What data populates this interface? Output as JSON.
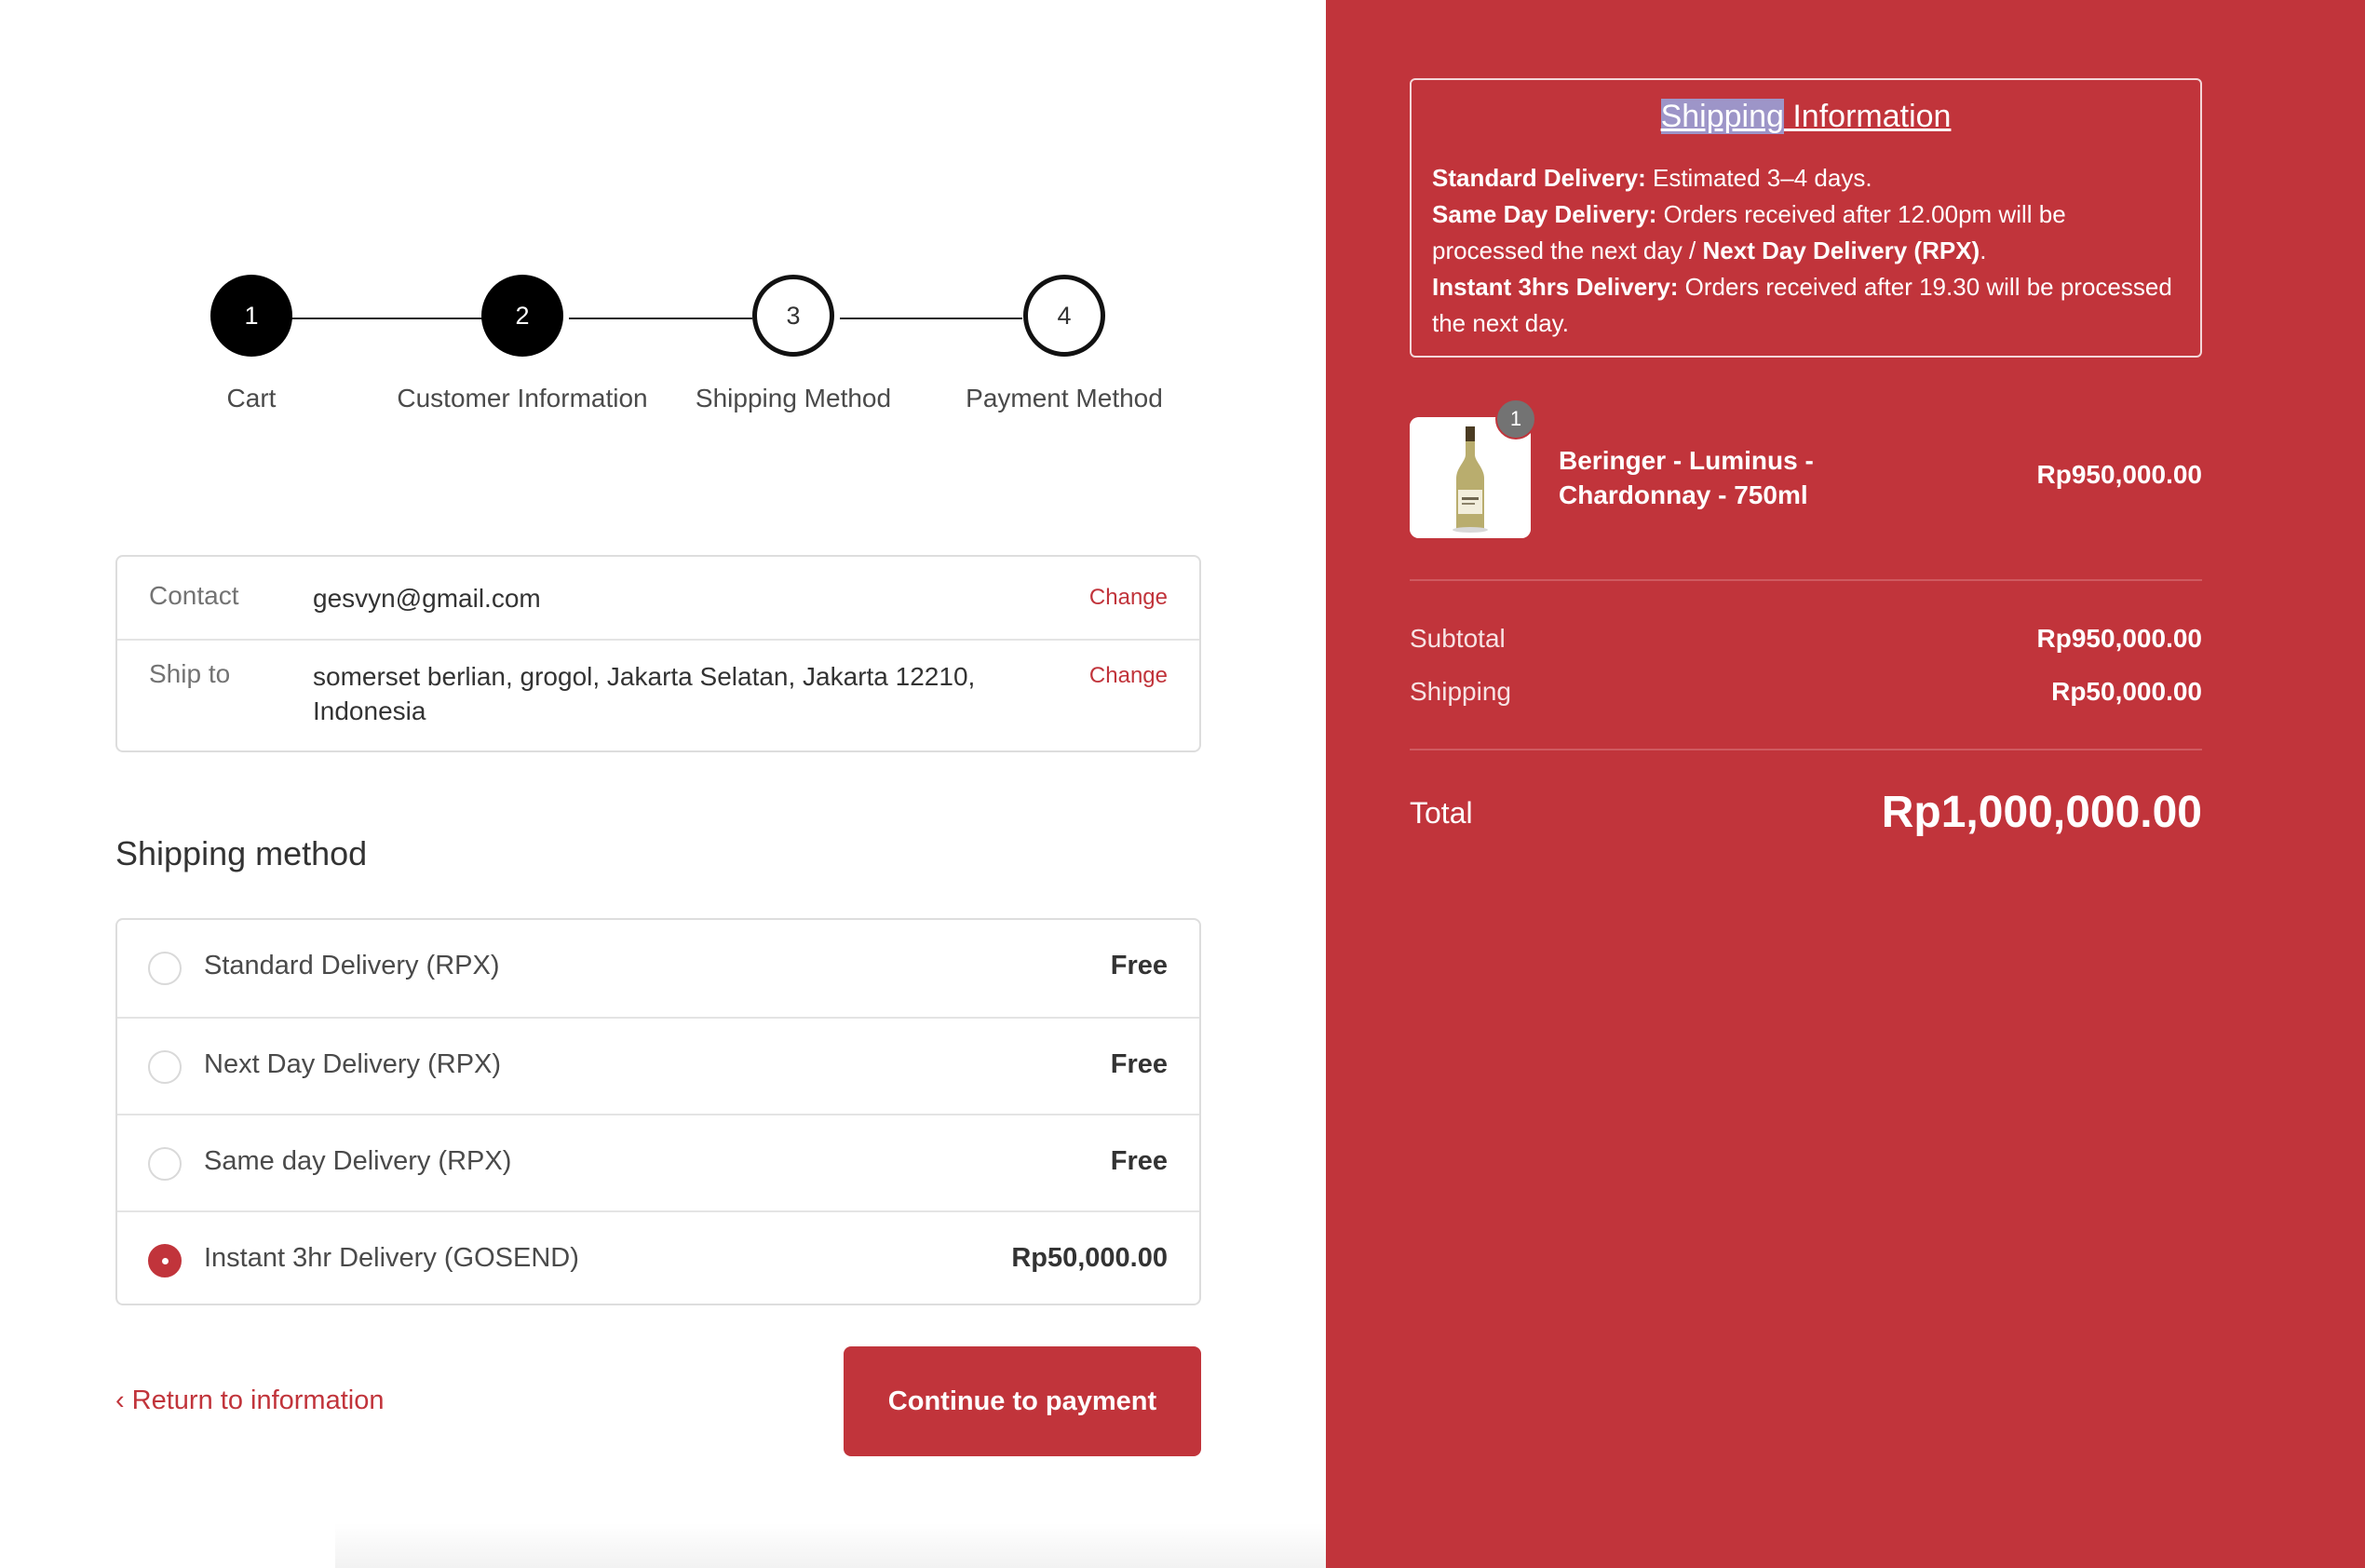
{
  "stepper": {
    "steps": [
      {
        "number": "1",
        "label": "Cart",
        "status": "done"
      },
      {
        "number": "2",
        "label": "Customer Information",
        "status": "done"
      },
      {
        "number": "3",
        "label": "Shipping Method",
        "status": "todo"
      },
      {
        "number": "4",
        "label": "Payment Method",
        "status": "todo"
      }
    ]
  },
  "review": {
    "contact_label": "Contact",
    "contact_value": "gesvyn@gmail.com",
    "ship_label": "Ship to",
    "ship_value": "somerset berlian, grogol, Jakarta Selatan, Jakarta 12210, Indonesia",
    "change_label": "Change"
  },
  "shipping": {
    "title": "Shipping method",
    "options": [
      {
        "label": "Standard Delivery (RPX)",
        "price": "Free",
        "selected": false
      },
      {
        "label": "Next Day Delivery (RPX)",
        "price": "Free",
        "selected": false
      },
      {
        "label": "Same day Delivery (RPX)",
        "price": "Free",
        "selected": false
      },
      {
        "label": "Instant 3hr Delivery (GOSEND)",
        "price": "Rp50,000.00",
        "selected": true
      }
    ]
  },
  "nav": {
    "return_label": "Return to information",
    "continue_label": "Continue to payment"
  },
  "info": {
    "title_highlight": "Shipping",
    "title_rest": " Information",
    "standard_label": "Standard Delivery:",
    "standard_text": " Estimated 3–4 days.",
    "sameday_label": "Same Day Delivery:",
    "sameday_text": " Orders received after 12.00pm will be processed the next day / ",
    "nextday_label": "Next Day Delivery (RPX)",
    "nextday_suffix": ".",
    "instant_label": "Instant 3hrs Delivery:",
    "instant_text": " Orders received after 19.30 will be processed the next day."
  },
  "order": {
    "item": {
      "quantity": "1",
      "name": "Beringer - Luminus - Chardonnay - 750ml",
      "price": "Rp950,000.00"
    },
    "subtotal_label": "Subtotal",
    "subtotal_value": "Rp950,000.00",
    "shipping_label": "Shipping",
    "shipping_value": "Rp50,000.00",
    "total_label": "Total",
    "total_value": "Rp1,000,000.00"
  },
  "colors": {
    "brand": "#c1343b",
    "step_done": "#000000"
  },
  "icons": {
    "return": "chevron-left-icon",
    "product": "wine-bottle-icon"
  }
}
